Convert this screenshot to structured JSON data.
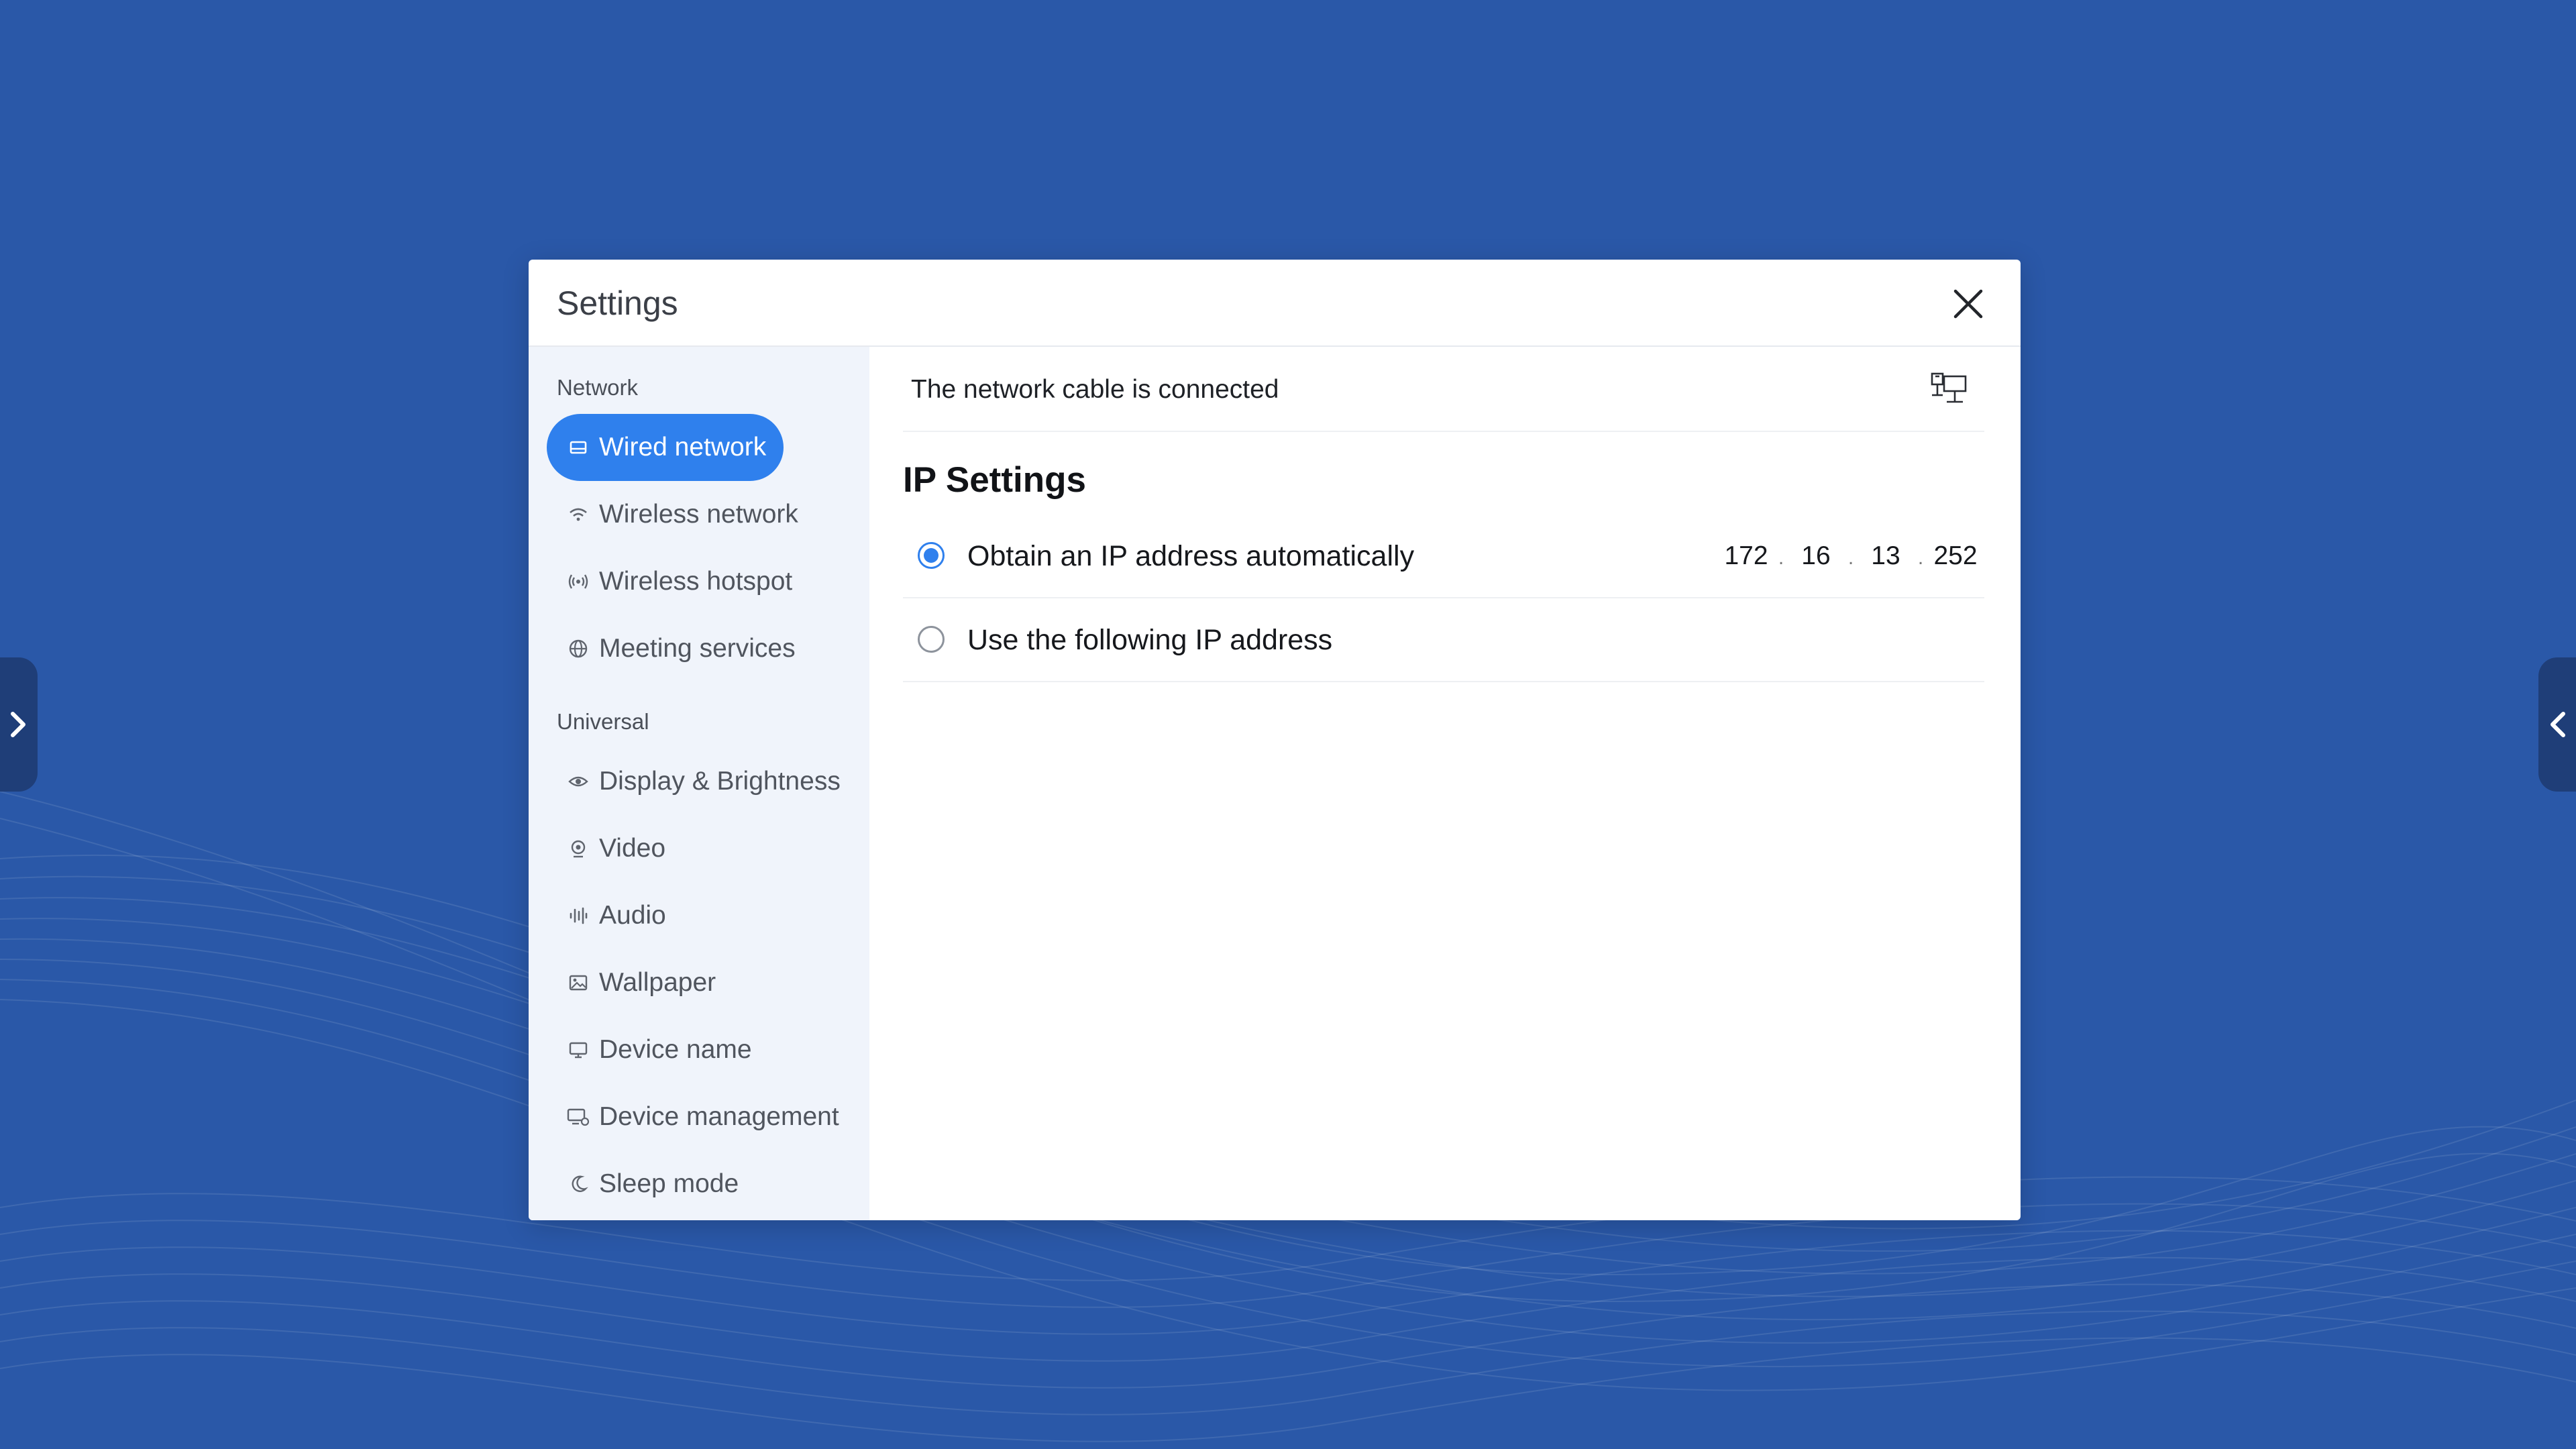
{
  "window": {
    "title": "Settings"
  },
  "sidebar": {
    "groups": [
      {
        "label": "Network",
        "items": [
          {
            "label": "Wired network",
            "icon": "wired-network-icon",
            "active": true
          },
          {
            "label": "Wireless network",
            "icon": "wifi-icon"
          },
          {
            "label": "Wireless hotspot",
            "icon": "hotspot-icon"
          },
          {
            "label": "Meeting services",
            "icon": "globe-icon"
          }
        ]
      },
      {
        "label": "Universal",
        "items": [
          {
            "label": "Display & Brightness",
            "icon": "eye-icon"
          },
          {
            "label": "Video",
            "icon": "camera-icon"
          },
          {
            "label": "Audio",
            "icon": "audio-wave-icon"
          },
          {
            "label": "Wallpaper",
            "icon": "image-icon"
          },
          {
            "label": "Device name",
            "icon": "monitor-icon"
          },
          {
            "label": "Device management",
            "icon": "device-settings-icon"
          },
          {
            "label": "Sleep mode",
            "icon": "moon-icon"
          }
        ]
      }
    ]
  },
  "content": {
    "status_text": "The network cable is connected",
    "section_title": "IP Settings",
    "options": [
      {
        "label": "Obtain an IP address automatically",
        "selected": true
      },
      {
        "label": "Use the following IP address",
        "selected": false
      }
    ],
    "ip_address": [
      "172",
      "16",
      "13",
      "252"
    ]
  },
  "colors": {
    "accent": "#2f80ed",
    "background": "#2a58a8",
    "sidebar_bg": "#f0f4fb"
  }
}
